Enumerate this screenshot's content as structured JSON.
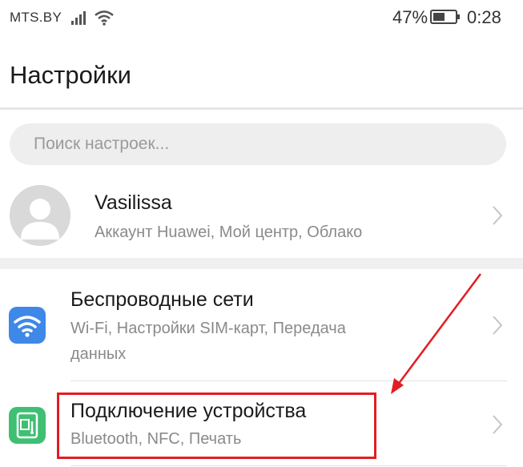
{
  "status_bar": {
    "carrier": "MTS.BY",
    "battery_percent": "47%",
    "time": "0:28",
    "icons": [
      "signal-icon",
      "wifi-icon",
      "battery-icon"
    ]
  },
  "header": {
    "title": "Настройки"
  },
  "search": {
    "placeholder": "Поиск настроек..."
  },
  "account": {
    "name": "Vasilissa",
    "subtitle": "Аккаунт Huawei, Мой центр, Облако",
    "icon": "avatar-icon"
  },
  "settings_items": [
    {
      "title": "Беспроводные сети",
      "subtitle_line1": "Wi-Fi, Настройки SIM-карт, Передача",
      "subtitle_line2": "данных",
      "icon": "wifi-icon",
      "icon_color": "#3e88e8"
    },
    {
      "title": "Подключение устройства",
      "subtitle": "Bluetooth, NFC, Печать",
      "icon": "device-connection-icon",
      "icon_color": "#3fbf72"
    }
  ],
  "annotation": {
    "highlight_color": "#e31c23"
  }
}
